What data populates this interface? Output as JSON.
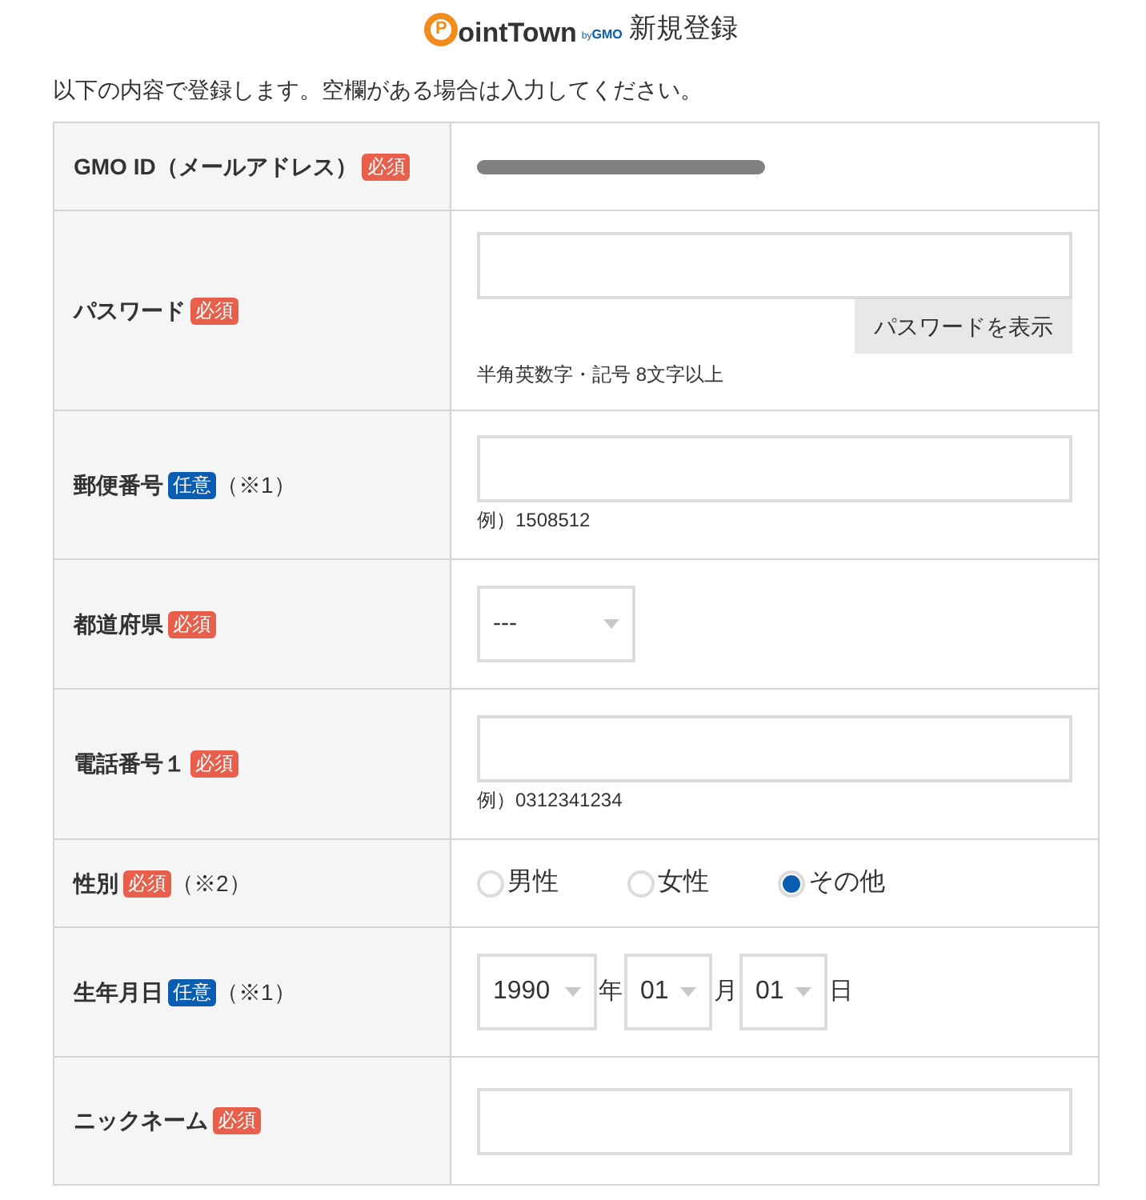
{
  "header": {
    "logo_mark": "P",
    "logo_text": "ointTown",
    "logo_by": "by",
    "logo_brand": "GMO",
    "title": "新規登録"
  },
  "intro": "以下の内容で登録します。空欄がある場合は入力してください。",
  "rows": [
    {
      "kind": "redacted",
      "label": "GMO ID（メールアドレス）",
      "badge": {
        "text": "必須",
        "color": "#e8604c"
      }
    },
    {
      "kind": "password",
      "label": "パスワード",
      "badge": {
        "text": "必須",
        "color": "#e8604c"
      },
      "button": "パスワードを表示",
      "hint": "半角英数字・記号 8文字以上"
    },
    {
      "kind": "text",
      "label": "郵便番号",
      "badge": {
        "text": "任意",
        "color": "#0a5db0"
      },
      "note": "（※1）",
      "hint": "例）1508512"
    },
    {
      "kind": "select",
      "label": "都道府県",
      "badge": {
        "text": "必須",
        "color": "#e8604c"
      },
      "value": "---"
    },
    {
      "kind": "text",
      "label": "電話番号１",
      "badge": {
        "text": "必須",
        "color": "#e8604c"
      },
      "hint": "例）0312341234"
    },
    {
      "kind": "radio",
      "label": "性別",
      "badge": {
        "text": "必須",
        "color": "#e8604c"
      },
      "note": "（※2）",
      "options": [
        {
          "label": "男性",
          "selected": false
        },
        {
          "label": "女性",
          "selected": false
        },
        {
          "label": "その他",
          "selected": true
        }
      ]
    },
    {
      "kind": "date",
      "label": "生年月日",
      "badge": {
        "text": "任意",
        "color": "#0a5db0"
      },
      "note": "（※1）",
      "parts": [
        {
          "value": "1990",
          "unit": "年"
        },
        {
          "value": "01",
          "unit": "月"
        },
        {
          "value": "01",
          "unit": "日"
        }
      ]
    },
    {
      "kind": "text",
      "label": "ニックネーム",
      "badge": {
        "text": "必須",
        "color": "#e8604c"
      }
    }
  ]
}
